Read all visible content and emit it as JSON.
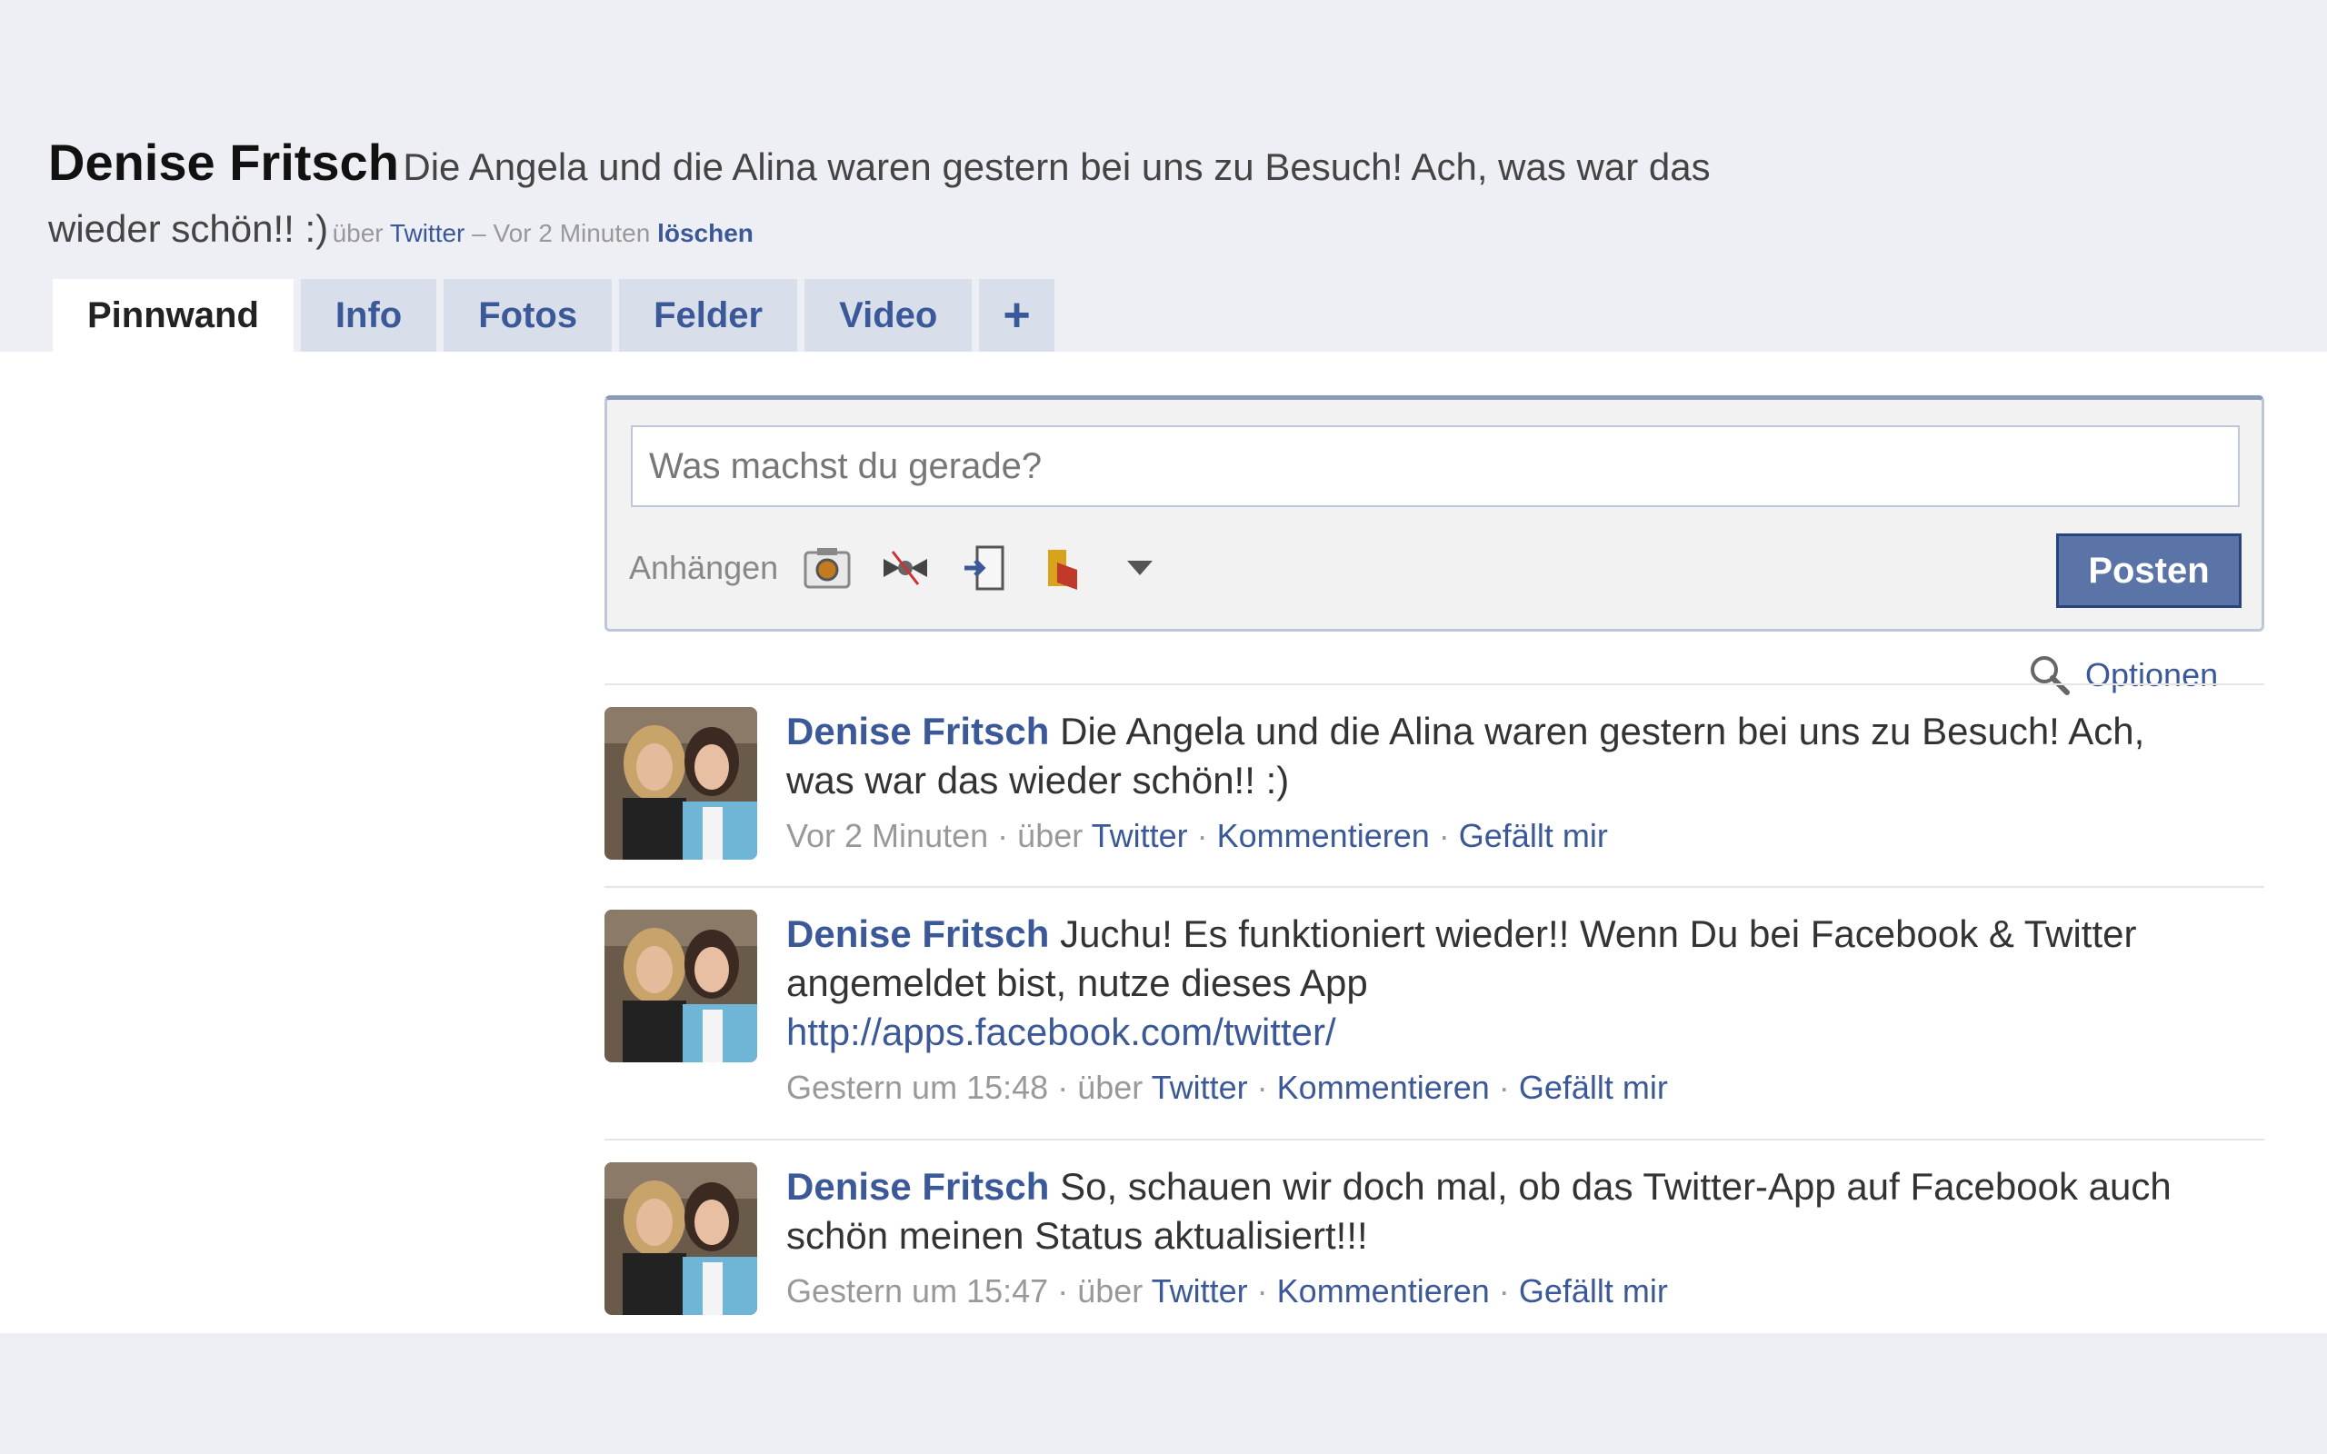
{
  "header": {
    "name": "Denise Fritsch",
    "status": "Die Angela und die Alina waren gestern bei uns zu Besuch! Ach, was war das wieder schön!! :)",
    "via_label": "über",
    "via_link": "Twitter",
    "separator": "–",
    "time": "Vor 2 Minuten",
    "delete": "löschen"
  },
  "tabs": [
    "Pinnwand",
    "Info",
    "Fotos",
    "Felder",
    "Video"
  ],
  "tab_plus": "+",
  "composer": {
    "placeholder": "Was machst du gerade?",
    "attach_label": "Anhängen",
    "icons": [
      "photo-icon",
      "event-icon",
      "link-icon",
      "video-icon"
    ],
    "dropdown": "chevron-down-icon",
    "post_label": "Posten"
  },
  "options": {
    "label": "Optionen",
    "icon": "magnifier-icon"
  },
  "stories": [
    {
      "author": "Denise Fritsch",
      "text": "Die Angela und die Alina waren gestern bei uns zu Besuch! Ach, was war das wieder schön!! :)",
      "link": "",
      "time": "Vor 2 Minuten",
      "via_label": "über",
      "via_link": "Twitter",
      "comment": "Kommentieren",
      "like": "Gefällt mir"
    },
    {
      "author": "Denise Fritsch",
      "text": "Juchu! Es funktioniert wieder!! Wenn Du bei Facebook & Twitter angemeldet bist, nutze dieses App",
      "link": "http://apps.facebook.com/twitter/",
      "time": "Gestern um 15:48",
      "via_label": "über",
      "via_link": "Twitter",
      "comment": "Kommentieren",
      "like": "Gefällt mir"
    },
    {
      "author": "Denise Fritsch",
      "text": "So, schauen wir doch mal, ob das Twitter-App auf Facebook auch schön meinen Status aktualisiert!!!",
      "link": "",
      "time": "Gestern um 15:47",
      "via_label": "über",
      "via_link": "Twitter",
      "comment": "Kommentieren",
      "like": "Gefällt mir"
    }
  ],
  "meta_dot": "·",
  "colors": {
    "link": "#3b5998",
    "page_bg": "#edeff4",
    "tab_bg": "#d8dfea",
    "button_bg": "#5b74a8"
  }
}
